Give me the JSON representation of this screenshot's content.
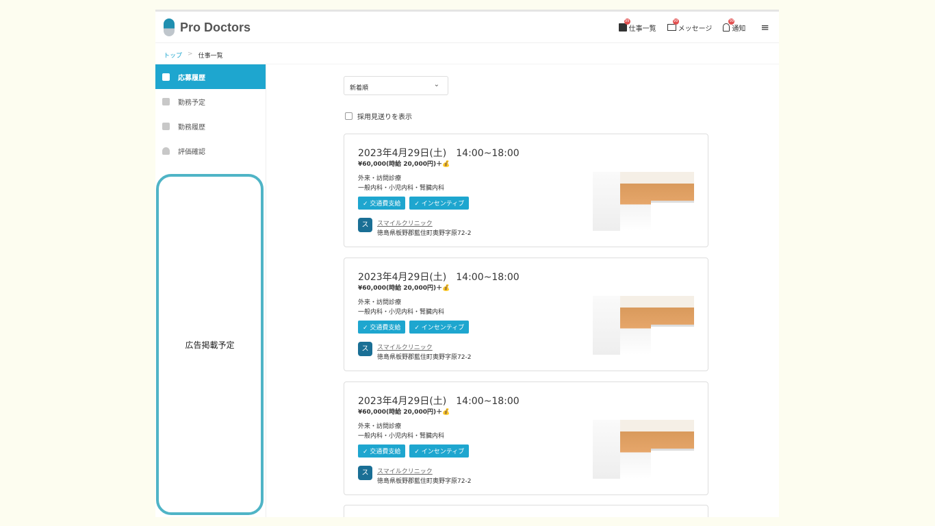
{
  "header": {
    "logo": "Pro Doctors",
    "nav": [
      {
        "label": "仕事一覧",
        "badge": "99",
        "icon": "job-list-icon"
      },
      {
        "label": "メッセージ",
        "badge": "99",
        "icon": "mail-icon"
      },
      {
        "label": "通知",
        "badge": "99",
        "icon": "bell-icon"
      }
    ]
  },
  "breadcrumb": {
    "home": "トップ",
    "sep": ">",
    "current": "仕事一覧"
  },
  "sidebar": {
    "items": [
      {
        "label": "応募履歴",
        "icon": "home-icon"
      },
      {
        "label": "勤務予定",
        "icon": "document-icon"
      },
      {
        "label": "勤務履歴",
        "icon": "id-card-icon"
      },
      {
        "label": "評価確認",
        "icon": "person-icon"
      }
    ],
    "ad": "広告掲載予定"
  },
  "main": {
    "sort": "新着順",
    "checkbox_label": "採用見送りを表示",
    "cards": [
      {
        "date": "2023年4月29日(土)　14:00~18:00",
        "pay": "¥60,000(時給 20,000円)＋💰",
        "type": "外来・訪問診療",
        "dept": "一般内科・小児内科・腎臓内科",
        "tags": [
          "✓ 交通費支給",
          "✓ インセンティブ"
        ],
        "avatar": "ス",
        "clinic": "スマイルクリニック",
        "address": "徳島県板野郡藍住町奥野字原72-2"
      },
      {
        "date": "2023年4月29日(土)　14:00~18:00",
        "pay": "¥60,000(時給 20,000円)＋💰",
        "type": "外来・訪問診療",
        "dept": "一般内科・小児内科・腎臓内科",
        "tags": [
          "✓ 交通費支給",
          "✓ インセンティブ"
        ],
        "avatar": "ス",
        "clinic": "スマイルクリニック",
        "address": "徳島県板野郡藍住町奥野字原72-2"
      },
      {
        "date": "2023年4月29日(土)　14:00~18:00",
        "pay": "¥60,000(時給 20,000円)＋💰",
        "type": "外来・訪問診療",
        "dept": "一般内科・小児内科・腎臓内科",
        "tags": [
          "✓ 交通費支給",
          "✓ インセンティブ"
        ],
        "avatar": "ス",
        "clinic": "スマイルクリニック",
        "address": "徳島県板野郡藍住町奥野字原72-2"
      }
    ]
  }
}
